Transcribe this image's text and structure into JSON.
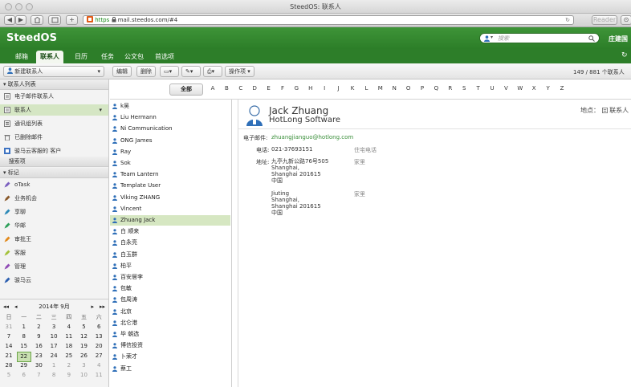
{
  "window": {
    "title": "SteedOS: 联系人"
  },
  "browser": {
    "url_scheme": "https",
    "url_rest": "mail.steedos.com/#4",
    "reader_label": "Reader"
  },
  "app": {
    "logo": "SteedOS",
    "search_placeholder": "搜索",
    "user_name": "庄建国"
  },
  "nav": {
    "tabs": [
      "邮箱",
      "联系人",
      "日历",
      "任务",
      "公文包",
      "首选项"
    ],
    "active": "联系人"
  },
  "actions": {
    "new_contact": "新建联系人",
    "edit": "编辑",
    "delete": "删除",
    "operations": "操作项",
    "count": "149 / 881 个联系人"
  },
  "sidebar": {
    "contact_list_header": "联系人列表",
    "contact_list_items": [
      "电子邮件联系人",
      "联系人",
      "通讯组列表",
      "已删除邮件",
      "骏马云客服的 客户"
    ],
    "search_header": "搜索项",
    "tags_header": "标记",
    "tags": [
      {
        "label": "oTask",
        "color": "#7b5fbf"
      },
      {
        "label": "业务机会",
        "color": "#8a5a2b"
      },
      {
        "label": "享聊",
        "color": "#2e8ab8"
      },
      {
        "label": "华邮",
        "color": "#2ea05a"
      },
      {
        "label": "审批王",
        "color": "#e28a1c"
      },
      {
        "label": "客服",
        "color": "#a4c23a"
      },
      {
        "label": "管理",
        "color": "#8f4bb5"
      },
      {
        "label": "骏马云",
        "color": "#2c5fb0"
      }
    ]
  },
  "calendar": {
    "month_label": "2014年 9月",
    "weekdays": [
      "日",
      "一",
      "二",
      "三",
      "四",
      "五",
      "六"
    ],
    "weeks": [
      [
        "31",
        "1",
        "2",
        "3",
        "4",
        "5",
        "6"
      ],
      [
        "7",
        "8",
        "9",
        "10",
        "11",
        "12",
        "13"
      ],
      [
        "14",
        "15",
        "16",
        "17",
        "18",
        "19",
        "20"
      ],
      [
        "21",
        "22",
        "23",
        "24",
        "25",
        "26",
        "27"
      ],
      [
        "28",
        "29",
        "30",
        "1",
        "2",
        "3",
        "4"
      ],
      [
        "5",
        "6",
        "7",
        "8",
        "9",
        "10",
        "11"
      ]
    ],
    "today": "22"
  },
  "alphabet": {
    "all_label": "全部",
    "letters": [
      "A",
      "B",
      "C",
      "D",
      "E",
      "F",
      "G",
      "H",
      "I",
      "J",
      "K",
      "L",
      "M",
      "N",
      "O",
      "P",
      "Q",
      "R",
      "S",
      "T",
      "U",
      "V",
      "W",
      "X",
      "Y",
      "Z"
    ]
  },
  "contacts": [
    "k吴",
    "Liu Hermann",
    "Ni Communication",
    "ONG James",
    "Ray",
    "Sok",
    "Team Lantern",
    "Template User",
    "Viking ZHANG",
    "Vincent",
    "Zhuang Jack",
    "白 顺来",
    "白永亮",
    "白玉群",
    "柏平",
    "百安居李",
    "包敏",
    "包周涛",
    "北京",
    "北仑港",
    "毕 朝选",
    "博信投资",
    "卜荣才",
    "蔡工"
  ],
  "selected_contact": "Zhuang Jack",
  "detail": {
    "name": "Jack Zhuang",
    "company": "HotLong Software",
    "locality_label": "地点：",
    "locality_value": "联系人",
    "email_label": "电子邮件:",
    "email_value": "zhuangjianguo@hotlong.com",
    "phone_label": "电话:",
    "phone_value": "021-37693151",
    "phone_type": "住宅电话",
    "address_label": "地址:",
    "address1": {
      "lines": [
        "九亭九新公路76号505",
        "Shanghai,",
        "Shanghai 201615",
        "中国"
      ],
      "type": "家里"
    },
    "address2": {
      "lines": [
        "Jiuting",
        "Shanghai,",
        "Shanghai 201615",
        "中国"
      ],
      "type": "家里"
    }
  }
}
